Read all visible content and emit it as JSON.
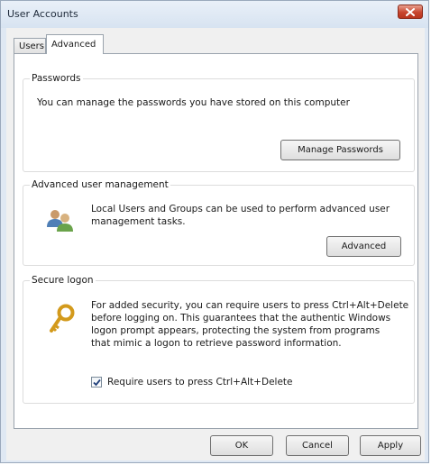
{
  "window": {
    "title": "User Accounts"
  },
  "tabs": [
    {
      "label": "Users",
      "selected": false
    },
    {
      "label": "Advanced",
      "selected": true
    }
  ],
  "passwords": {
    "legend": "Passwords",
    "description": "You can manage the passwords you have stored on this computer",
    "button": "Manage Passwords"
  },
  "advanced_management": {
    "legend": "Advanced user management",
    "description_line1": "Local Users and Groups can be used to perform advanced user",
    "description_line2": "management tasks.",
    "button": "Advanced",
    "icon": "users-icon"
  },
  "secure_logon": {
    "legend": "Secure logon",
    "description_line1": "For added security, you can require users to press Ctrl+Alt+Delete",
    "description_line2": "before logging on. This guarantees that the authentic Windows",
    "description_line3": "logon prompt appears, protecting the system from programs",
    "description_line4": "that mimic a logon to retrieve password information.",
    "icon": "key-icon",
    "checkbox_label": "Require users to press Ctrl+Alt+Delete",
    "checkbox_checked": true
  },
  "footer": {
    "ok": "OK",
    "cancel": "Cancel",
    "apply": "Apply"
  },
  "colors": {
    "close_button": "#c8452e",
    "titlebar": "#dfe8f3"
  }
}
